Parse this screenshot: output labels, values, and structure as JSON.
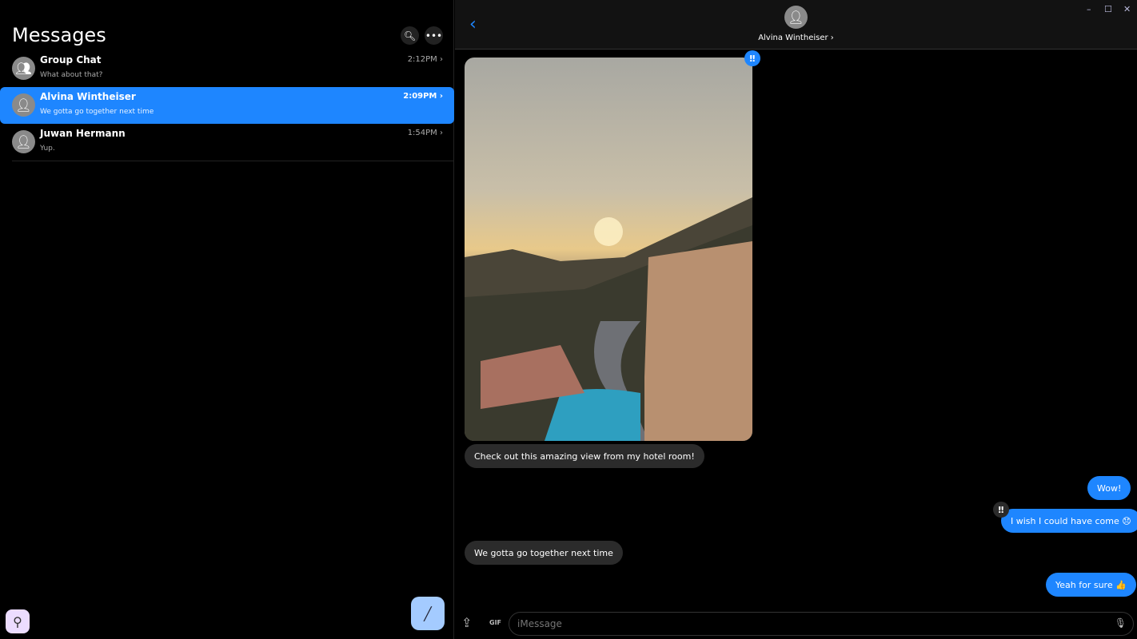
{
  "sidebar": {
    "title": "Messages",
    "conversations": [
      {
        "name": "Group Chat",
        "preview": "What about that?",
        "time": "2:12PM",
        "selected": false
      },
      {
        "name": "Alvina Wintheiser",
        "preview": "We gotta go together next time",
        "time": "2:09PM",
        "selected": true
      },
      {
        "name": "Juwan Hermann",
        "preview": "Yup.",
        "time": "1:54PM",
        "selected": false
      }
    ]
  },
  "header": {
    "contact_name": "Alvina Wintheiser"
  },
  "messages": [
    {
      "text": "Check out this amazing view from my hotel room!",
      "dir": "in"
    },
    {
      "text": "Wow!",
      "dir": "out"
    },
    {
      "text": "I wish I could have come 😞",
      "dir": "out"
    },
    {
      "text": "We gotta go together next time",
      "dir": "in"
    },
    {
      "text": "Yeah for sure 👍",
      "dir": "out"
    }
  ],
  "composer": {
    "placeholder": "iMessage",
    "gif_label": "GIF"
  },
  "tapback": "‼",
  "colors": {
    "accent": "#1e86ff",
    "incoming": "#2b2b2b"
  }
}
